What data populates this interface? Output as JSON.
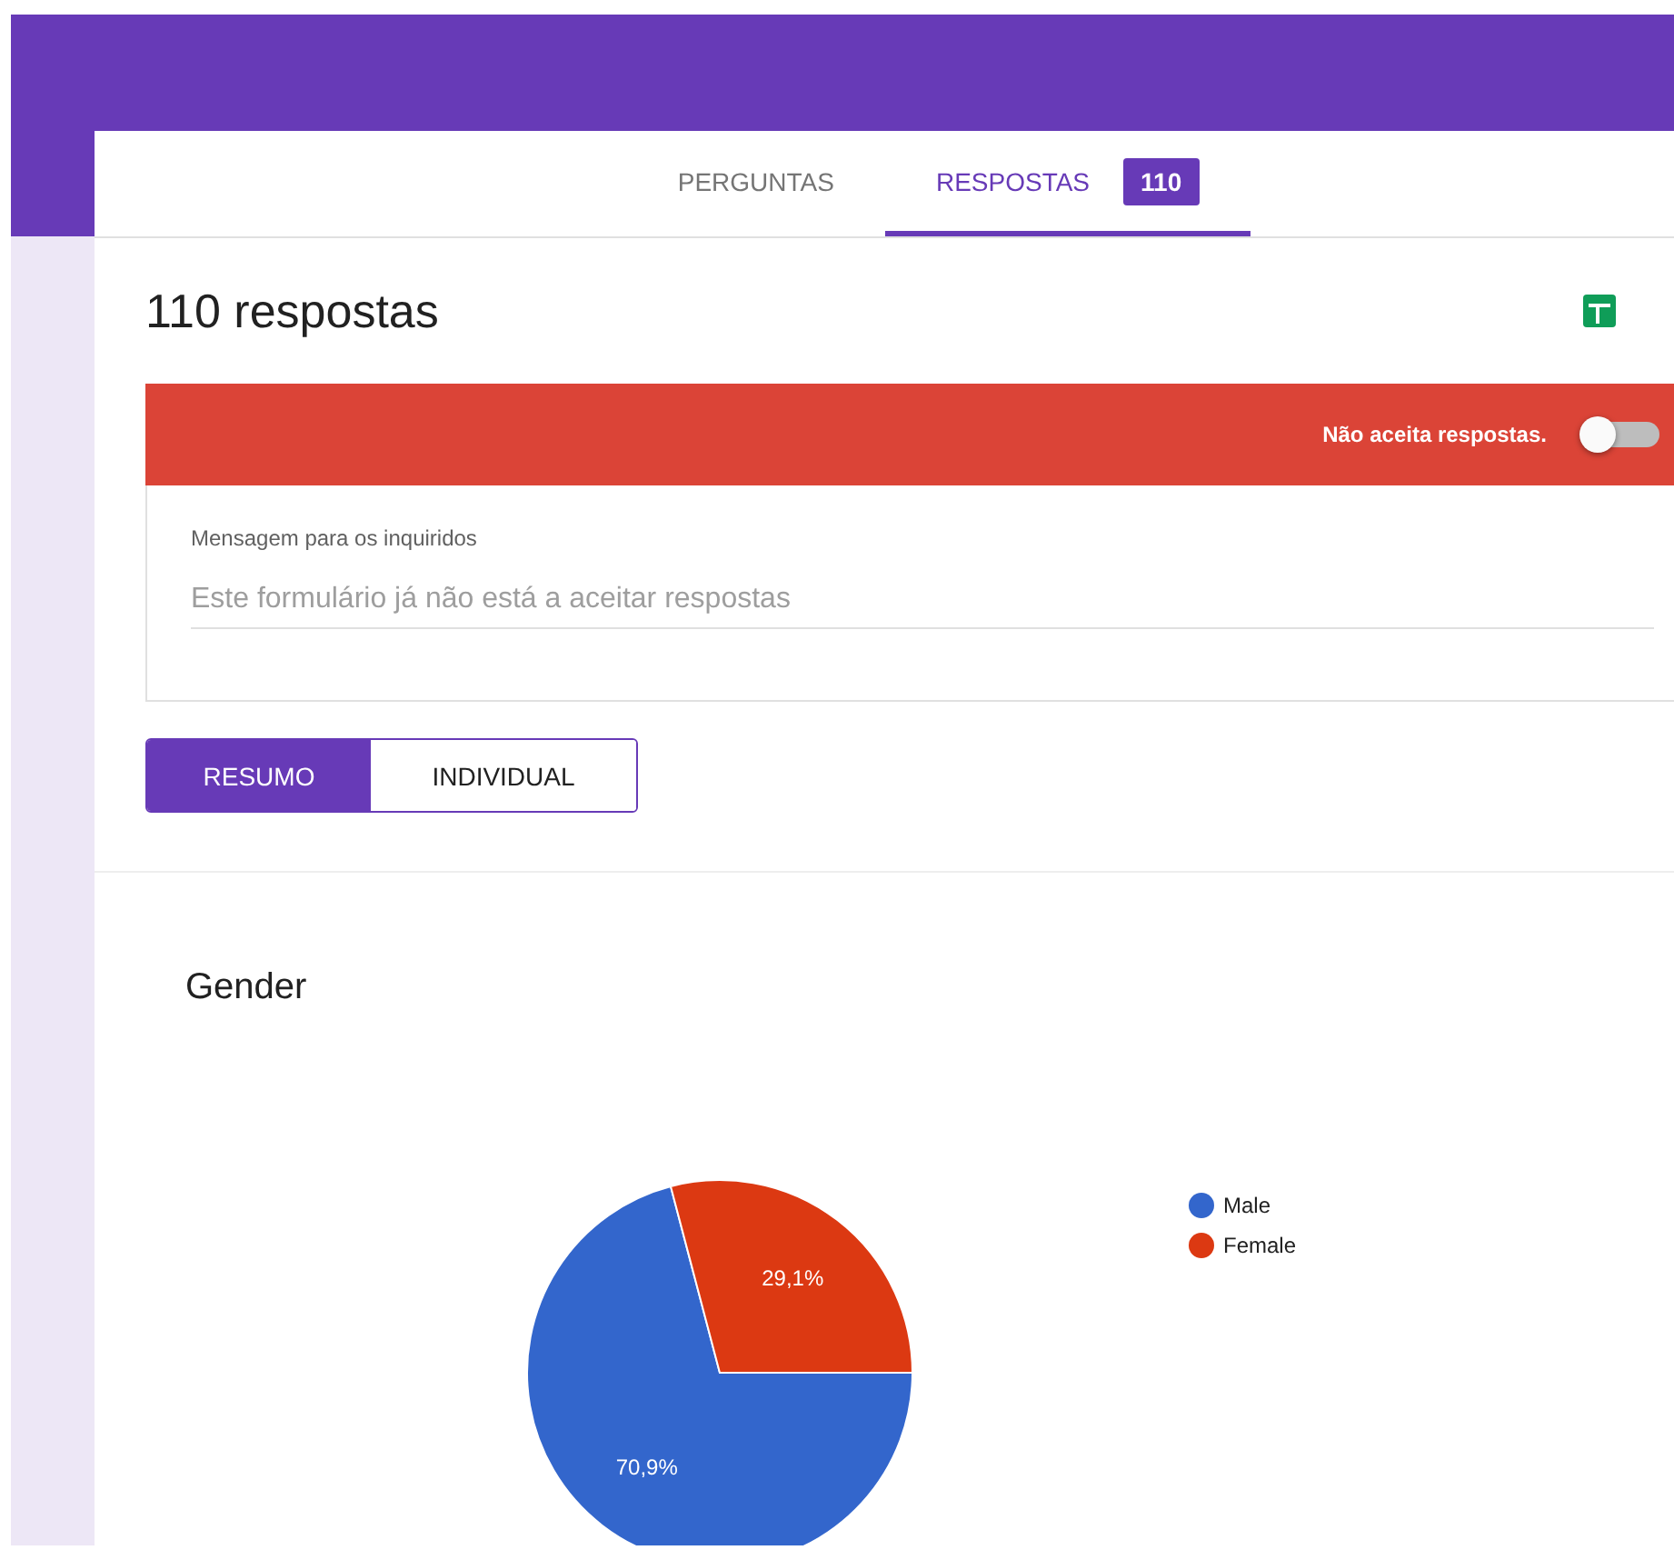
{
  "tabs": [
    {
      "label": "PERGUNTAS",
      "selected": false
    },
    {
      "label": "RESPOSTAS",
      "selected": true,
      "badge": "110"
    }
  ],
  "title": "110 respostas",
  "accepting_banner": {
    "label": "Não aceita respostas.",
    "on": false
  },
  "message": {
    "label": "Mensagem para os inquiridos",
    "placeholder": "Este formulário já não está a aceitar respostas"
  },
  "view_toggle": [
    {
      "label": "RESUMO",
      "selected": true
    },
    {
      "label": "INDIVIDUAL",
      "selected": false
    }
  ],
  "question": {
    "title": "Gender",
    "chart_data": {
      "type": "pie",
      "categories": [
        "Male",
        "Female"
      ],
      "values": [
        70.9,
        29.1
      ],
      "legend": "right",
      "colors": [
        "#3366cc",
        "#dc3912"
      ],
      "value_labels": [
        "70,9%",
        "29,1%"
      ]
    }
  }
}
